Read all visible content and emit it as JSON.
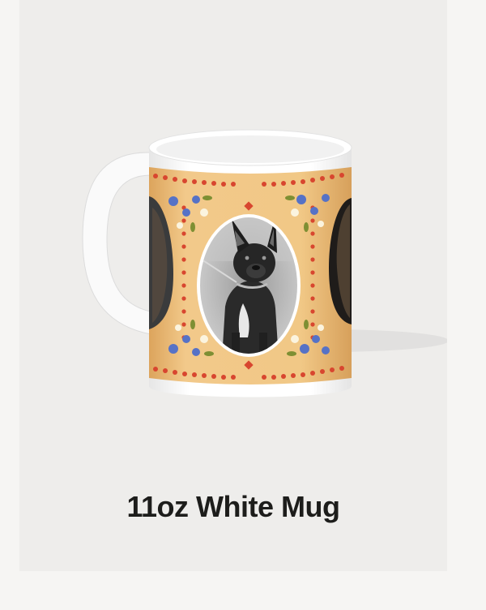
{
  "product": {
    "title": "11oz White Mug"
  },
  "colors": {
    "card_bg": "#eeedeb",
    "band": "#f2c98a",
    "mug_white": "#ffffff",
    "title": "#1d1d1b"
  }
}
